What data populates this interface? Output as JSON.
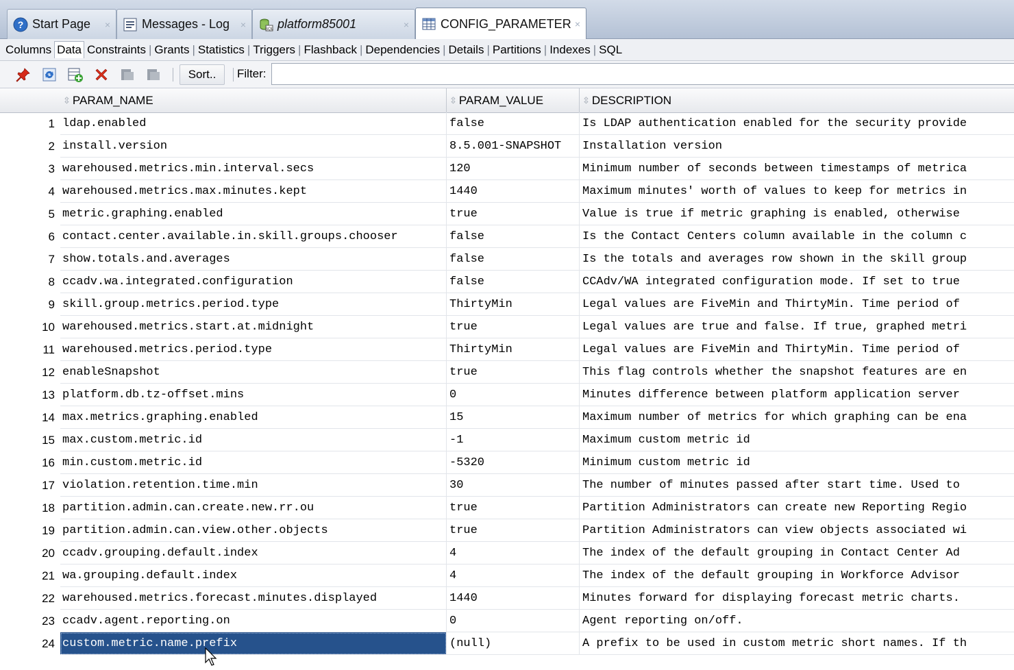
{
  "doc_tabs": [
    {
      "label": "Start Page",
      "icon": "help-icon"
    },
    {
      "label": "Messages - Log",
      "icon": "log-icon"
    },
    {
      "label": "platform85001",
      "icon": "database-connection-icon"
    },
    {
      "label": "CONFIG_PARAMETER",
      "icon": "table-icon",
      "active": true
    }
  ],
  "sub_tabs": [
    "Columns",
    "Data",
    "Constraints",
    "Grants",
    "Statistics",
    "Triggers",
    "Flashback",
    "Dependencies",
    "Details",
    "Partitions",
    "Indexes",
    "SQL"
  ],
  "sub_tab_sep": "|",
  "tab_close_glyph": "×",
  "sort_glyph": "⇳",
  "toolbar": {
    "icons": [
      "pin-icon",
      "refresh-icon",
      "insert-row-icon",
      "delete-row-icon",
      "commit-icon",
      "rollback-icon"
    ],
    "sort_label": "Sort..",
    "filter_label": "Filter:",
    "filter_value": ""
  },
  "grid": {
    "columns": [
      "PARAM_NAME",
      "PARAM_VALUE",
      "DESCRIPTION"
    ],
    "selected_row": 24,
    "rows": [
      {
        "n": "1",
        "name": "ldap.enabled",
        "value": "false",
        "desc": "Is LDAP authentication enabled for the security provide"
      },
      {
        "n": "2",
        "name": "install.version",
        "value": "8.5.001-SNAPSHOT",
        "desc": "Installation version"
      },
      {
        "n": "3",
        "name": "warehoused.metrics.min.interval.secs",
        "value": "120",
        "desc": "Minimum number of seconds between timestamps of metrica"
      },
      {
        "n": "4",
        "name": "warehoused.metrics.max.minutes.kept",
        "value": "1440",
        "desc": "Maximum minutes' worth of values to keep for metrics in"
      },
      {
        "n": "5",
        "name": "metric.graphing.enabled",
        "value": "true",
        "desc": "Value is true if metric graphing is enabled, otherwise"
      },
      {
        "n": "6",
        "name": "contact.center.available.in.skill.groups.chooser",
        "value": "false",
        "desc": "Is the Contact Centers column available in the column c"
      },
      {
        "n": "7",
        "name": "show.totals.and.averages",
        "value": "false",
        "desc": "Is the totals and averages row shown in the skill group"
      },
      {
        "n": "8",
        "name": "ccadv.wa.integrated.configuration",
        "value": "false",
        "desc": " CCAdv/WA integrated configuration mode. If set to true"
      },
      {
        "n": "9",
        "name": "skill.group.metrics.period.type",
        "value": "ThirtyMin",
        "desc": "Legal values are FiveMin and ThirtyMin. Time period of"
      },
      {
        "n": "10",
        "name": "warehoused.metrics.start.at.midnight",
        "value": "true",
        "desc": "Legal values are true and false. If true, graphed metri"
      },
      {
        "n": "11",
        "name": "warehoused.metrics.period.type",
        "value": "ThirtyMin",
        "desc": "Legal values are FiveMin and ThirtyMin. Time period of"
      },
      {
        "n": "12",
        "name": "enableSnapshot",
        "value": "true",
        "desc": "This flag controls whether the snapshot features are en"
      },
      {
        "n": "13",
        "name": "platform.db.tz-offset.mins",
        "value": "0",
        "desc": "Minutes difference between platform application server"
      },
      {
        "n": "14",
        "name": "max.metrics.graphing.enabled",
        "value": "15",
        "desc": "Maximum number of metrics for which graphing can be ena"
      },
      {
        "n": "15",
        "name": "max.custom.metric.id",
        "value": "-1",
        "desc": "Maximum custom metric id"
      },
      {
        "n": "16",
        "name": "min.custom.metric.id",
        "value": "-5320",
        "desc": "Minimum custom metric id"
      },
      {
        "n": "17",
        "name": "violation.retention.time.min",
        "value": "30",
        "desc": "The number of minutes passed after start time. Used to"
      },
      {
        "n": "18",
        "name": "partition.admin.can.create.new.rr.ou",
        "value": "true",
        "desc": "Partition Administrators can create new Reporting Regio"
      },
      {
        "n": "19",
        "name": "partition.admin.can.view.other.objects",
        "value": "true",
        "desc": "Partition Administrators can view objects associated wi"
      },
      {
        "n": "20",
        "name": "ccadv.grouping.default.index",
        "value": "4",
        "desc": " The index of the default grouping in Contact Center Ad"
      },
      {
        "n": "21",
        "name": "wa.grouping.default.index",
        "value": "4",
        "desc": " The index of the default grouping in Workforce Advisor"
      },
      {
        "n": "22",
        "name": "warehoused.metrics.forecast.minutes.displayed",
        "value": "1440",
        "desc": "Minutes forward for displaying forecast metric charts."
      },
      {
        "n": "23",
        "name": "ccadv.agent.reporting.on",
        "value": "0",
        "desc": "Agent reporting on/off."
      },
      {
        "n": "24",
        "name": "custom.metric.name.prefix",
        "value": "(null)",
        "desc": "A prefix to be used in custom metric short names. If th"
      }
    ]
  },
  "colors": {
    "selection": "#26528c",
    "delete_icon": "#d9301c",
    "pin_icon": "#d62a1a"
  }
}
